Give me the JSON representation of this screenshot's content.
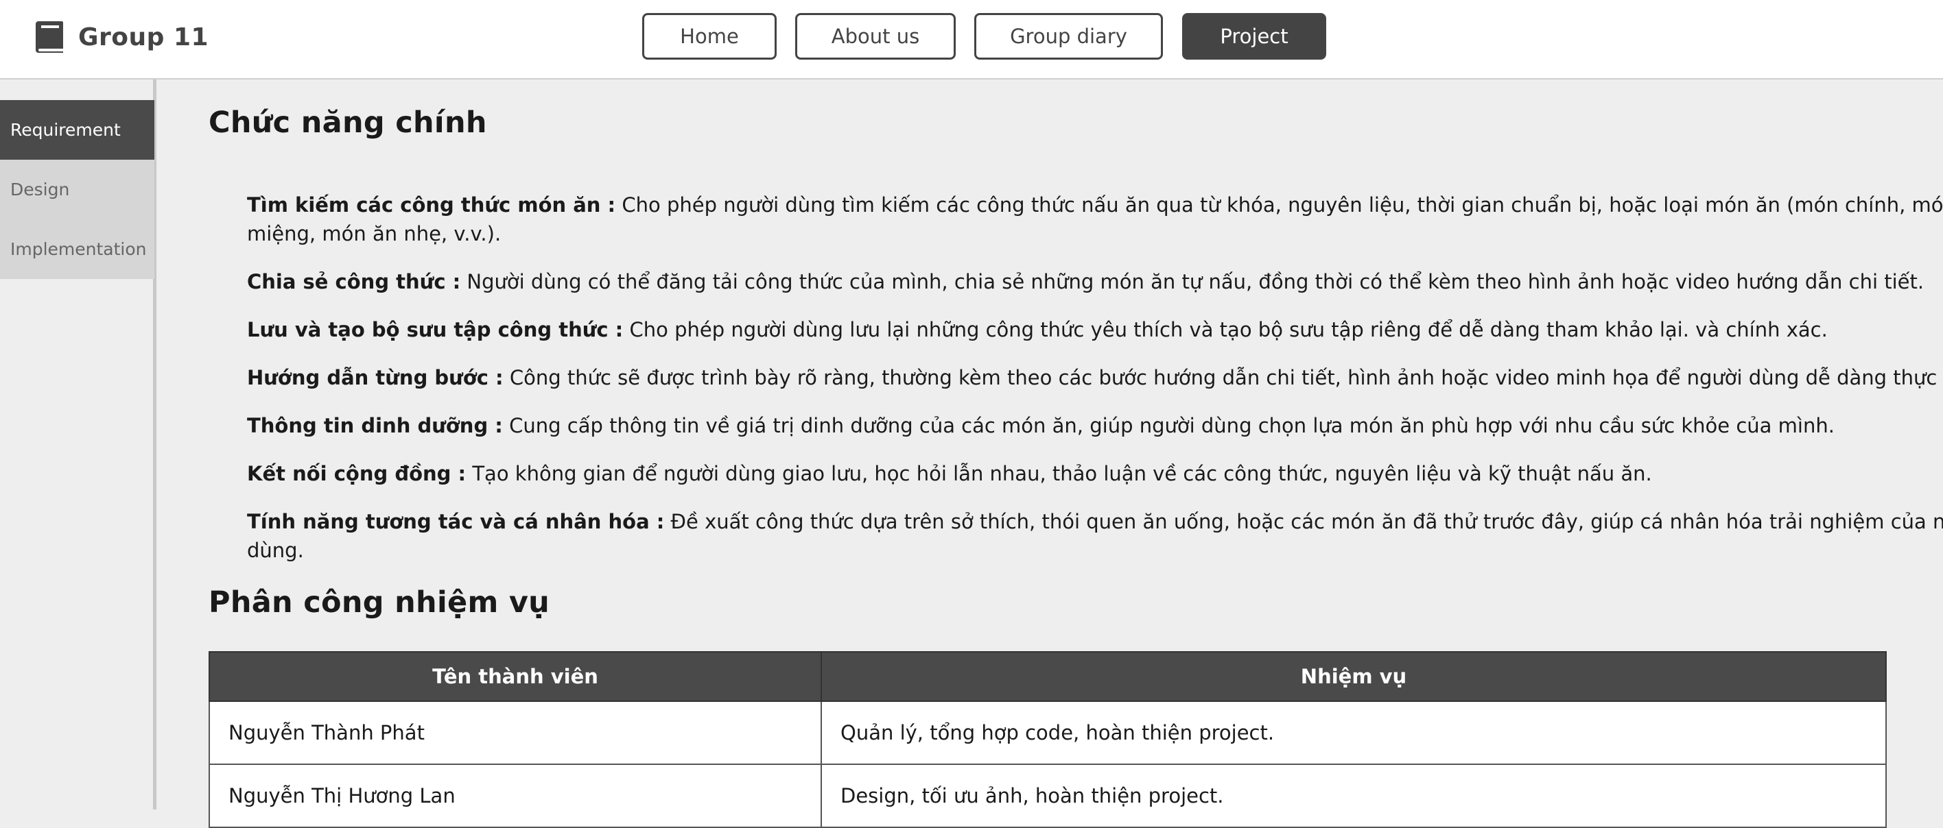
{
  "header": {
    "brand_icon": "book-icon",
    "brand_title": "Group 11",
    "nav": [
      {
        "label": "Home",
        "active": false
      },
      {
        "label": "About us",
        "active": false
      },
      {
        "label": "Group diary",
        "active": false
      },
      {
        "label": "Project",
        "active": true
      }
    ]
  },
  "sidebar": {
    "items": [
      {
        "label": "Requirement",
        "active": true
      },
      {
        "label": "Design",
        "active": false
      },
      {
        "label": "Implementation",
        "active": false
      }
    ]
  },
  "main": {
    "section1_title": "Chức năng chính",
    "features": [
      {
        "name": "Tìm kiếm các công thức món ăn :",
        "desc": " Cho phép người dùng tìm kiếm các công thức nấu ăn qua từ khóa, nguyên liệu, thời gian chuẩn bị, hoặc loại món ăn (món chính, món tráng miệng, món ăn nhẹ, v.v.)."
      },
      {
        "name": "Chia sẻ công thức :",
        "desc": " Người dùng có thể đăng tải công thức của mình, chia sẻ những món ăn tự nấu, đồng thời có thể kèm theo hình ảnh hoặc video hướng dẫn chi tiết."
      },
      {
        "name": "Lưu và tạo bộ sưu tập công thức :",
        "desc": " Cho phép người dùng lưu lại những công thức yêu thích và tạo bộ sưu tập riêng để dễ dàng tham khảo lại. và chính xác."
      },
      {
        "name": "Hướng dẫn từng bước :",
        "desc": " Công thức sẽ được trình bày rõ ràng, thường kèm theo các bước hướng dẫn chi tiết, hình ảnh hoặc video minh họa để người dùng dễ dàng thực hiện."
      },
      {
        "name": "Thông tin dinh dưỡng :",
        "desc": " Cung cấp thông tin về giá trị dinh dưỡng của các món ăn, giúp người dùng chọn lựa món ăn phù hợp với nhu cầu sức khỏe của mình."
      },
      {
        "name": "Kết nối cộng đồng :",
        "desc": " Tạo không gian để người dùng giao lưu, học hỏi lẫn nhau, thảo luận về các công thức, nguyên liệu và kỹ thuật nấu ăn."
      },
      {
        "name": "Tính năng tương tác và cá nhân hóa :",
        "desc": " Đề xuất công thức dựa trên sở thích, thói quen ăn uống, hoặc các món ăn đã thử trước đây, giúp cá nhân hóa trải nghiệm của người dùng."
      }
    ],
    "section2_title": "Phân công nhiệm vụ",
    "table": {
      "headers": [
        "Tên thành viên",
        "Nhiệm vụ"
      ],
      "rows": [
        [
          "Nguyễn Thành Phát",
          "Quản lý, tổng hợp code, hoàn thiện project."
        ],
        [
          "Nguyễn Thị Hương Lan",
          "Design, tối ưu ảnh, hoàn thiện project."
        ]
      ]
    }
  }
}
